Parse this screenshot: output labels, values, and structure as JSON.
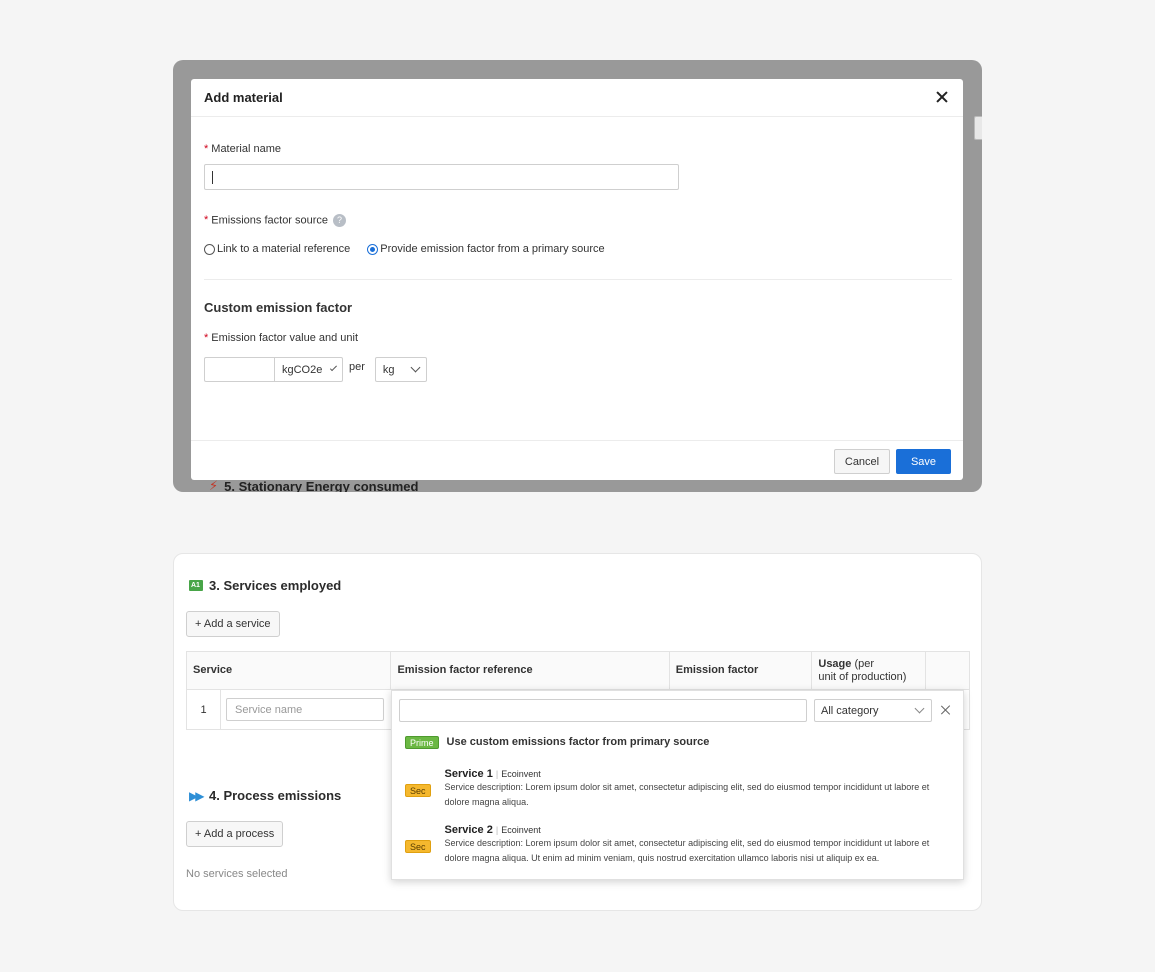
{
  "modal": {
    "title": "Add material",
    "material_name_label": "Material name",
    "emissions_source_label": "Emissions factor source",
    "help_glyph": "?",
    "radio_options": [
      "Link to a material reference",
      "Provide emission factor from a primary source"
    ],
    "selected_option_index": 1,
    "section_title": "Custom emission factor",
    "emission_value_label": "Emission factor value and unit",
    "unit_numerator": "kgCO2e",
    "per_label": "per",
    "unit_denominator": "kg",
    "cancel_label": "Cancel",
    "save_label": "Save",
    "required_mark": "*"
  },
  "background": {
    "behind_section_label": "5. Stationary Energy consumed"
  },
  "services": {
    "section_title": "3. Services employed",
    "add_label": "+ Add a service",
    "columns": {
      "service": "Service",
      "reference": "Emission factor reference",
      "factor": "Emission factor",
      "usage_main": "Usage",
      "usage_paren_1": "(per",
      "usage_paren_2": "unit of production)"
    },
    "row_index": "1",
    "service_placeholder": "Service name"
  },
  "dropdown": {
    "category": "All category",
    "custom_tag": "Prime",
    "custom_label": "Use custom emissions factor from primary source",
    "items": [
      {
        "tag": "Sec",
        "name": "Service 1",
        "source": "Ecoinvent",
        "description": "Service description: Lorem ipsum dolor sit amet, consectetur adipiscing elit, sed do eiusmod tempor incididunt ut labore et dolore magna aliqua."
      },
      {
        "tag": "Sec",
        "name": "Service 2",
        "source": "Ecoinvent",
        "description": "Service description: Lorem ipsum dolor sit amet, consectetur adipiscing elit, sed do eiusmod tempor incididunt ut labore et dolore magna aliqua. Ut enim ad minim veniam, quis nostrud exercitation ullamco laboris nisi ut aliquip ex ea."
      }
    ]
  },
  "process": {
    "section_title": "4. Process emissions",
    "add_label": "+ Add a process",
    "empty_text": "No services selected"
  },
  "colors": {
    "primary": "#1a6fd8",
    "required": "#d0021b",
    "prime_tag": "#6bb843",
    "sec_tag": "#f5b82e",
    "backdrop": "#999999"
  }
}
